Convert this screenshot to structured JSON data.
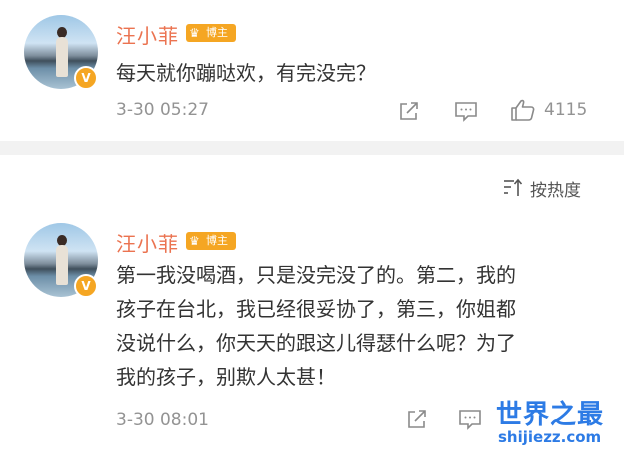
{
  "comments": [
    {
      "username": "汪小菲",
      "badge_label": "博主",
      "verified_mark": "V",
      "text": "每天就你蹦哒欢，有完没完？",
      "timestamp": "3-30 05:27",
      "like_count": "4115",
      "actions": [
        "share-icon",
        "comment-icon",
        "like-icon"
      ]
    },
    {
      "username": "汪小菲",
      "badge_label": "博主",
      "verified_mark": "V",
      "text_lines": [
        "第一我没喝酒，只是没完没了的。第二，我的",
        "孩子在台北，我已经很妥协了，第三，你姐都",
        "没说什么，你天天的跟这儿得瑟什么呢？为了",
        "我的孩子，别欺人太甚！"
      ],
      "timestamp": "3-30 08:01",
      "actions": [
        "share-icon",
        "comment-icon"
      ]
    }
  ],
  "sort": {
    "label": "按热度",
    "icon": "sort-icon"
  },
  "watermark": {
    "title": "世界之最",
    "url": "shijiezz.com"
  },
  "colors": {
    "username": "#eb7350",
    "badge": "#f5a623",
    "watermark": "#2d7be5",
    "meta": "#939393"
  }
}
